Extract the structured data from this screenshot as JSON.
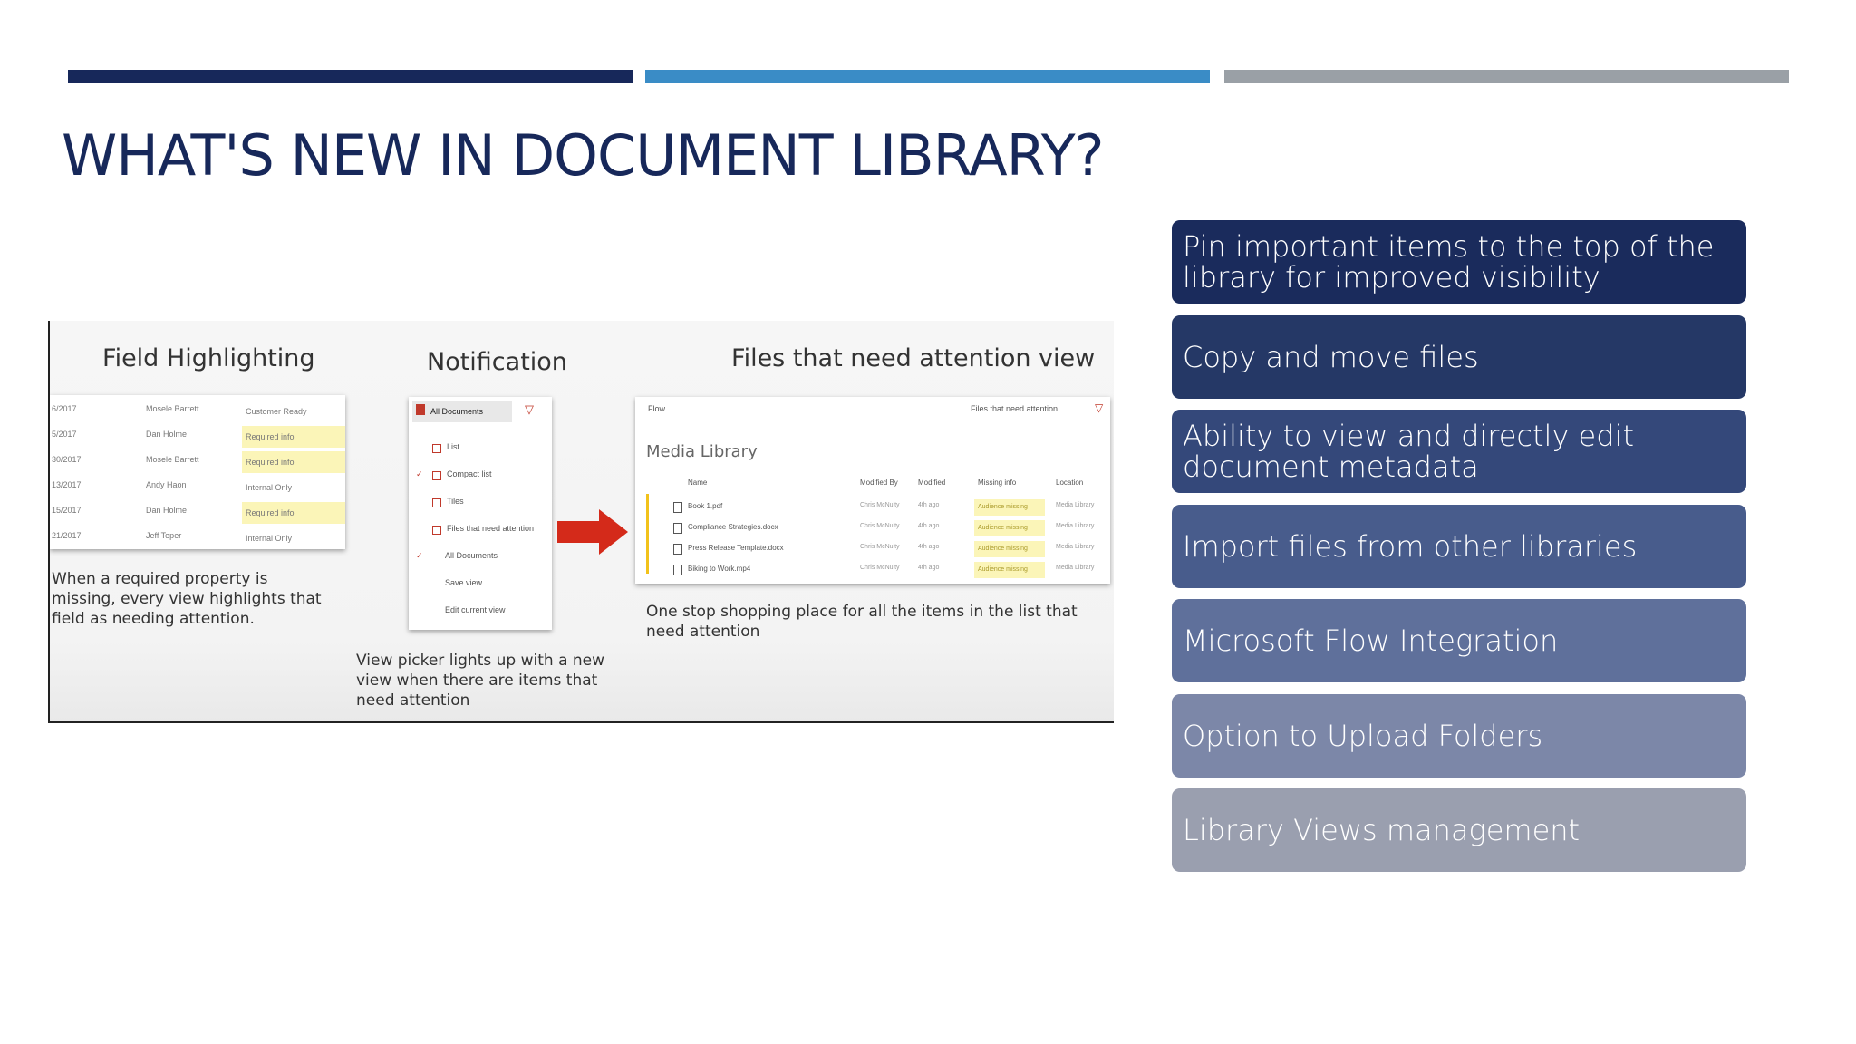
{
  "slide": {
    "title": "WHAT'S NEW IN DOCUMENT LIBRARY?",
    "accent_colors": [
      "#17285a",
      "#3a8cc6",
      "#9aa0a6"
    ]
  },
  "screenshot": {
    "field_highlighting": {
      "heading": "Field Highlighting",
      "caption": "When a required property is missing, every view highlights that field as needing attention.",
      "rows": [
        [
          "6/2017",
          "Mosele Barrett",
          "Customer Ready"
        ],
        [
          "5/2017",
          "Dan Holme",
          "Required info"
        ],
        [
          "30/2017",
          "Mosele Barrett",
          "Required info"
        ],
        [
          "13/2017",
          "Andy Haon",
          "Internal Only"
        ],
        [
          "15/2017",
          "Dan Holme",
          "Required info"
        ],
        [
          "21/2017",
          "Jeff Teper",
          "Internal Only"
        ]
      ]
    },
    "notification": {
      "heading": "Notification",
      "caption": "View picker lights up with a new view when there are items that need attention",
      "dropdown": "All Documents",
      "menu_items": [
        "List",
        "Compact list",
        "Tiles",
        "Files that need attention",
        "All Documents",
        "Save view",
        "Edit current view"
      ]
    },
    "attention_view": {
      "heading": "Files that need attention view",
      "caption": "One stop shopping place for all the items in the list that need attention",
      "library_name": "Media Library",
      "toolbar_left": "Flow",
      "toolbar_right": "Files that need attention",
      "columns": [
        "Name",
        "Modified By",
        "Modified",
        "Missing info",
        "Location"
      ],
      "files": [
        "Book 1.pdf",
        "Compliance Strategies.docx",
        "Press Release Template.docx",
        "Biking to Work.mp4"
      ],
      "cell_modified_by": "Chris McNulty",
      "cell_modified": "4th ago",
      "cell_missing": "Audience missing",
      "cell_location": "Media Library"
    }
  },
  "features": [
    {
      "label": "Pin important items to the top of the library for improved visibility",
      "color": "#1a2b5c"
    },
    {
      "label": "Copy and move files",
      "color": "#253866"
    },
    {
      "label": "Ability to view and directly edit document metadata",
      "color": "#34487a"
    },
    {
      "label": "Import files from other libraries",
      "color": "#485c8c"
    },
    {
      "label": "Microsoft Flow Integration",
      "color": "#5f709b"
    },
    {
      "label": "Option to Upload Folders",
      "color": "#7c87a8"
    },
    {
      "label": "Library Views management",
      "color": "#9a9faf"
    }
  ]
}
